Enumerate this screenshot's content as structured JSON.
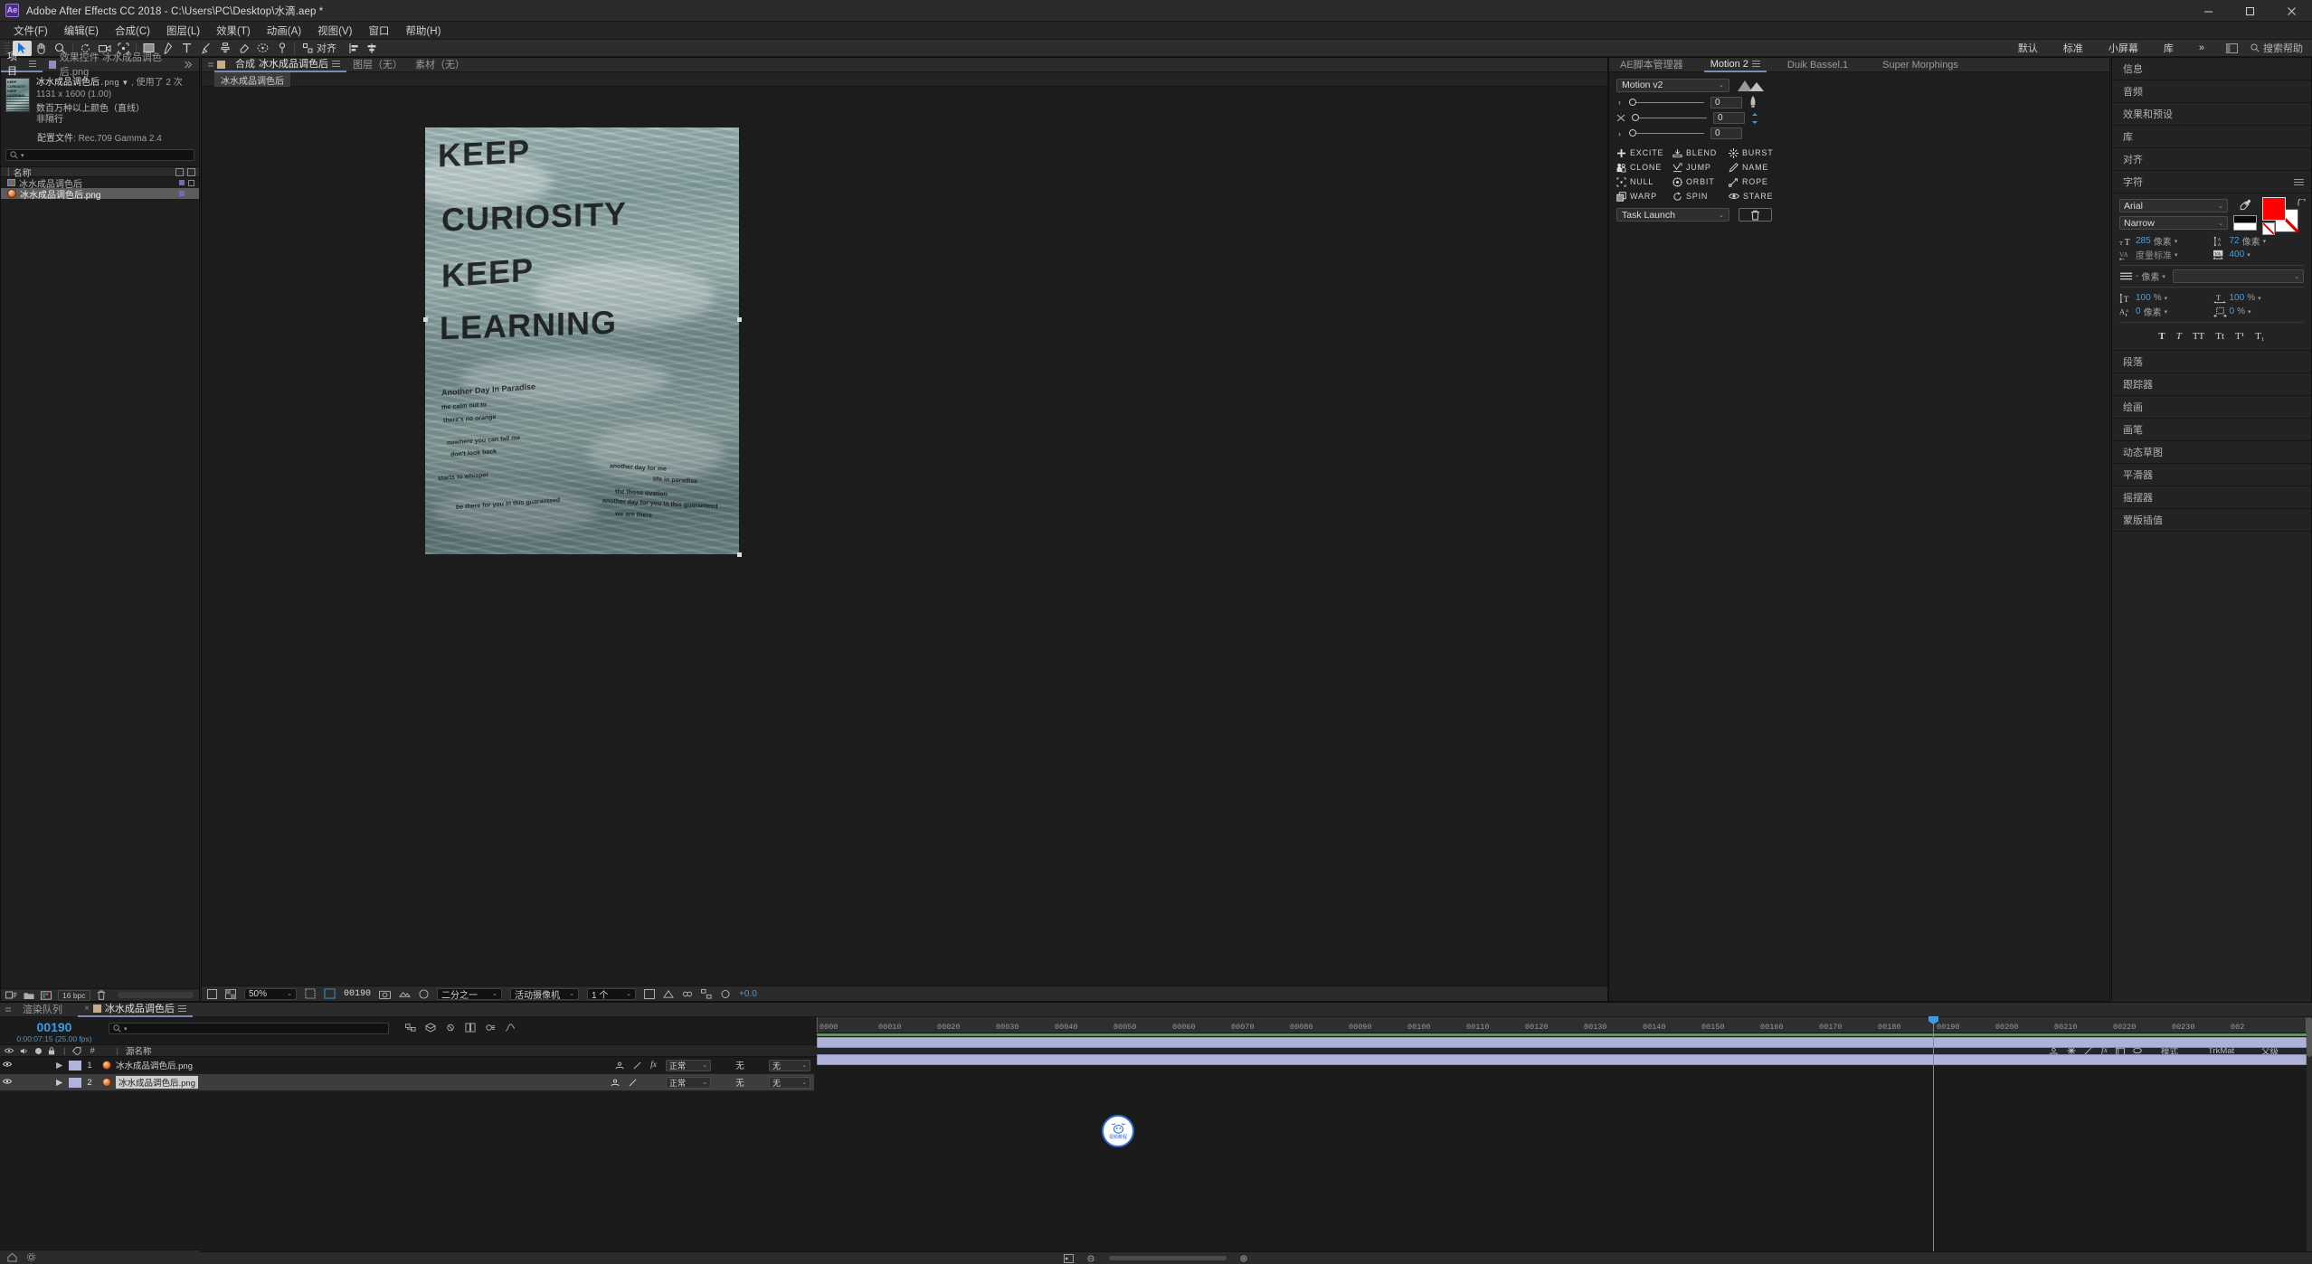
{
  "window": {
    "app_logo": "Ae",
    "title": "Adobe After Effects CC 2018 - C:\\Users\\PC\\Desktop\\水滴.aep *",
    "minimize": "minimize-icon",
    "maximize": "maximize-icon",
    "close": "close-icon"
  },
  "menu": {
    "items": [
      {
        "label": "文件(F)"
      },
      {
        "label": "编辑(E)"
      },
      {
        "label": "合成(C)"
      },
      {
        "label": "图层(L)"
      },
      {
        "label": "效果(T)"
      },
      {
        "label": "动画(A)"
      },
      {
        "label": "视图(V)"
      },
      {
        "label": "窗口"
      },
      {
        "label": "帮助(H)"
      }
    ]
  },
  "toolbar": {
    "tools": [
      {
        "name": "selection-tool",
        "active": true
      },
      {
        "name": "hand-tool",
        "active": false
      },
      {
        "name": "zoom-tool",
        "active": false
      },
      {
        "name": "rotation-tool",
        "active": false
      },
      {
        "name": "camera-tool",
        "active": false
      },
      {
        "name": "pan-behind-tool",
        "active": false
      },
      {
        "name": "shape-tool",
        "active": false
      },
      {
        "name": "pen-tool",
        "active": false
      },
      {
        "name": "type-tool",
        "active": false
      },
      {
        "name": "brush-tool",
        "active": false
      },
      {
        "name": "clone-stamp-tool",
        "active": false
      },
      {
        "name": "eraser-tool",
        "active": false
      },
      {
        "name": "roto-brush-tool",
        "active": false
      },
      {
        "name": "puppet-tool",
        "active": false
      }
    ],
    "snapping_label": "对齐",
    "workspaces": [
      "默认",
      "标准",
      "小屏幕",
      "库"
    ],
    "overflow": "»",
    "search_help_placeholder": "搜索帮助"
  },
  "project_panel": {
    "tabs": [
      {
        "label": "项目",
        "active": true
      },
      {
        "label": "效果控件 冰水成品调色后.png",
        "active": false
      }
    ],
    "selected_asset": {
      "filename": "冰水成品调色后",
      "extension": ".png",
      "usage": "使用了 2 次",
      "dimensions": "1131 x 1600 (1.00)",
      "color_depth": "数百万种以上颜色（直线）",
      "interlace": "非隔行",
      "profile_label": "配置文件",
      "profile_value": "Rec.709 Gamma 2.4"
    },
    "search_placeholder": "",
    "column_header": "名称",
    "items": [
      {
        "name": "冰水成品调色后",
        "type": "composition",
        "selected": false
      },
      {
        "name": "冰水成品调色后.png",
        "type": "footage-png",
        "selected": true
      }
    ],
    "footer": {
      "bpc": "16 bpc"
    }
  },
  "comp_panel": {
    "tabs": [
      {
        "label": "合成",
        "sub": "冰水成品调色后",
        "active": true
      },
      {
        "label": "图层（无）",
        "active": false
      },
      {
        "label": "素材（无）",
        "active": false
      }
    ],
    "subtab_chip": "冰水成品调色后",
    "artwork": {
      "headline_lines": [
        "KEEP",
        "CURIOSITY",
        "KEEP",
        "LEARNING"
      ],
      "sub_title": "Another Day In Paradise",
      "body_lines": [
        "the calm out to",
        "there's no orange",
        "nowhere you can fall me",
        "don't look back",
        "starts to whisper",
        "another day for me",
        "life in paradise",
        "another day for you in this guaranteed",
        "the those ovation",
        "be there for you in this guaranteed",
        "we are there"
      ]
    },
    "footer": {
      "zoom": "50%",
      "timecode": "00190",
      "resolution": "二分之一",
      "camera": "活动摄像机",
      "views": "1 个",
      "exposure": "+0.0"
    }
  },
  "script_panel": {
    "tabs": [
      {
        "label": "AE脚本管理器",
        "active": false
      },
      {
        "label": "Motion 2",
        "active": true
      },
      {
        "label": "Duik Bassel.1",
        "active": false
      },
      {
        "label": "Super Morphings",
        "active": false
      }
    ],
    "version_select": "Motion v2",
    "sliders": [
      {
        "value": "0"
      },
      {
        "value": "0"
      },
      {
        "value": "0"
      }
    ],
    "tools": [
      {
        "label": "EXCITE",
        "icon": "plus-icon"
      },
      {
        "label": "BLEND",
        "icon": "blend-icon"
      },
      {
        "label": "BURST",
        "icon": "burst-icon"
      },
      {
        "label": "CLONE",
        "icon": "clone-icon"
      },
      {
        "label": "JUMP",
        "icon": "jump-icon"
      },
      {
        "label": "NAME",
        "icon": "pencil-icon"
      },
      {
        "label": "NULL",
        "icon": "null-icon"
      },
      {
        "label": "ORBIT",
        "icon": "orbit-icon"
      },
      {
        "label": "ROPE",
        "icon": "rope-icon"
      },
      {
        "label": "WARP",
        "icon": "warp-icon"
      },
      {
        "label": "SPIN",
        "icon": "spin-icon"
      },
      {
        "label": "STARE",
        "icon": "eye-icon"
      }
    ],
    "task_launch": "Task Launch",
    "delete_icon": "trash-icon"
  },
  "right_panel": {
    "accordions_top": [
      {
        "label": "信息"
      },
      {
        "label": "音频"
      },
      {
        "label": "效果和预设"
      },
      {
        "label": "库"
      },
      {
        "label": "对齐"
      }
    ],
    "character": {
      "title": "字符",
      "font_family": "Arial",
      "font_style": "Narrow",
      "font_size": "285",
      "font_size_unit": "像素",
      "leading": "72",
      "leading_unit": "像素",
      "kerning": "度量标准",
      "tracking": "400",
      "stroke_width": "-",
      "stroke_width_unit": "像素",
      "stroke_style": "",
      "vertical_scale": "100",
      "vertical_scale_unit": "%",
      "horizontal_scale": "100",
      "horizontal_scale_unit": "%",
      "baseline_shift": "0",
      "baseline_shift_unit": "像素",
      "tsume": "0",
      "tsume_unit": "%",
      "fill_color": "#ff0000",
      "stroke_color": "#ffffff",
      "styles": [
        "T",
        "T",
        "TT",
        "Tt",
        "T¹",
        "T₁"
      ]
    },
    "accordions_bottom": [
      {
        "label": "段落"
      },
      {
        "label": "跟踪器"
      },
      {
        "label": "绘画"
      },
      {
        "label": "画笔"
      },
      {
        "label": "动态草图"
      },
      {
        "label": "平滑器"
      },
      {
        "label": "摇摆器"
      },
      {
        "label": "蒙版插值"
      }
    ]
  },
  "timeline": {
    "tabs": [
      {
        "label": "渲染队列",
        "active": false
      },
      {
        "label": "冰水成品调色后",
        "active": true
      }
    ],
    "current_time": "00190",
    "time_detail": "0:00:07:15 (25.00 fps)",
    "search_placeholder": "",
    "columns": {
      "source_name": "源名称",
      "mode": "模式",
      "trkmat": "TrkMat",
      "parent": "父级"
    },
    "layers": [
      {
        "index": "1",
        "name": "冰水成品调色后.png",
        "mode": "正常",
        "trkmat": "无",
        "parent": "无",
        "selected": false
      },
      {
        "index": "2",
        "name": "冰水成品调色后.png",
        "mode": "正常",
        "trkmat": "无",
        "parent": "无",
        "selected": true
      }
    ],
    "ruler_ticks": [
      "0000",
      "00010",
      "00020",
      "00030",
      "00040",
      "00050",
      "00060",
      "00070",
      "00080",
      "00090",
      "00100",
      "00110",
      "00120",
      "00130",
      "00140",
      "00150",
      "00160",
      "00170",
      "00180",
      "00190",
      "00200",
      "00210",
      "00220",
      "00230",
      "002"
    ],
    "playhead_label": "00190",
    "badge": {
      "line1": "视频",
      "line2": "教程"
    }
  }
}
